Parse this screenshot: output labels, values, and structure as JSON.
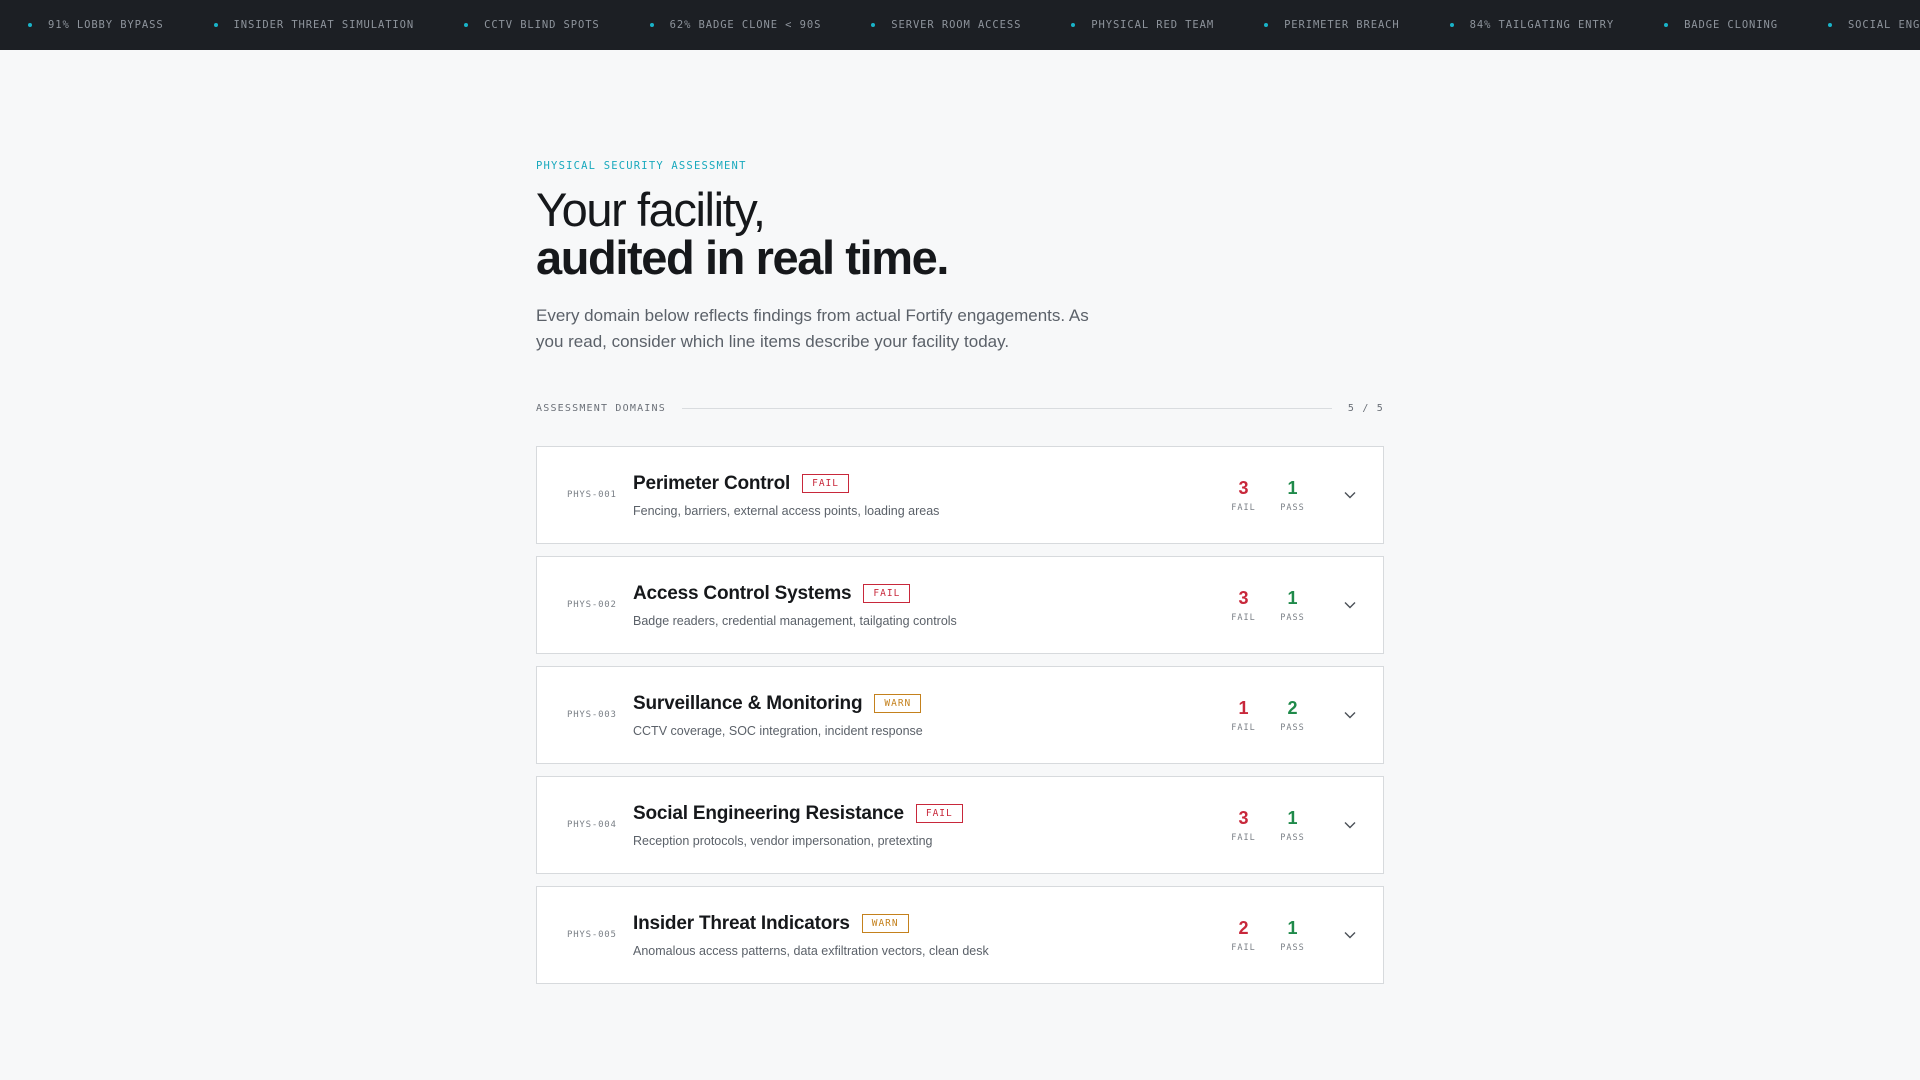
{
  "ticker": {
    "items": [
      "91% LOBBY BYPASS",
      "INSIDER THREAT SIMULATION",
      "CCTV BLIND SPOTS",
      "62% BADGE CLONE < 90S",
      "SERVER ROOM ACCESS",
      "PHYSICAL RED TEAM",
      "PERIMETER BREACH",
      "84% TAILGATING ENTRY",
      "BADGE CLONING",
      "SOCIAL ENGINEERING"
    ],
    "dot_color": "#19b3c8"
  },
  "hero": {
    "eyebrow": "PHYSICAL SECURITY ASSESSMENT",
    "headline_line1": "Your facility,",
    "headline_line2": "audited in real time.",
    "lede": "Every domain below reflects findings from actual Fortify engagements. As you read, consider which line items describe your facility today."
  },
  "section": {
    "label": "ASSESSMENT DOMAINS",
    "count": "5 / 5"
  },
  "stat_labels": {
    "fail": "FAIL",
    "pass": "PASS"
  },
  "domains": [
    {
      "code": "PHYS-001",
      "title": "Perimeter Control",
      "status": "FAIL",
      "status_type": "fail",
      "description": "Fencing, barriers, external access points, loading areas",
      "fail": "3",
      "pass": "1",
      "icon": "chevron-down-icon"
    },
    {
      "code": "PHYS-002",
      "title": "Access Control Systems",
      "status": "FAIL",
      "status_type": "fail",
      "description": "Badge readers, credential management, tailgating controls",
      "fail": "3",
      "pass": "1",
      "icon": "chevron-down-icon"
    },
    {
      "code": "PHYS-003",
      "title": "Surveillance & Monitoring",
      "status": "WARN",
      "status_type": "warn",
      "description": "CCTV coverage, SOC integration, incident response",
      "fail": "1",
      "pass": "2",
      "icon": "chevron-down-icon"
    },
    {
      "code": "PHYS-004",
      "title": "Social Engineering Resistance",
      "status": "FAIL",
      "status_type": "fail",
      "description": "Reception protocols, vendor impersonation, pretexting",
      "fail": "3",
      "pass": "1",
      "icon": "chevron-down-icon"
    },
    {
      "code": "PHYS-005",
      "title": "Insider Threat Indicators",
      "status": "WARN",
      "status_type": "warn",
      "description": "Anomalous access patterns, data exfiltration vectors, clean desk",
      "fail": "2",
      "pass": "1",
      "icon": "chevron-down-icon"
    }
  ],
  "colors": {
    "fail": "#c8283b",
    "warn": "#c4811d",
    "pass": "#1f8a4a",
    "accent": "#19a9bd",
    "ticker_bg": "#1c1f24"
  }
}
